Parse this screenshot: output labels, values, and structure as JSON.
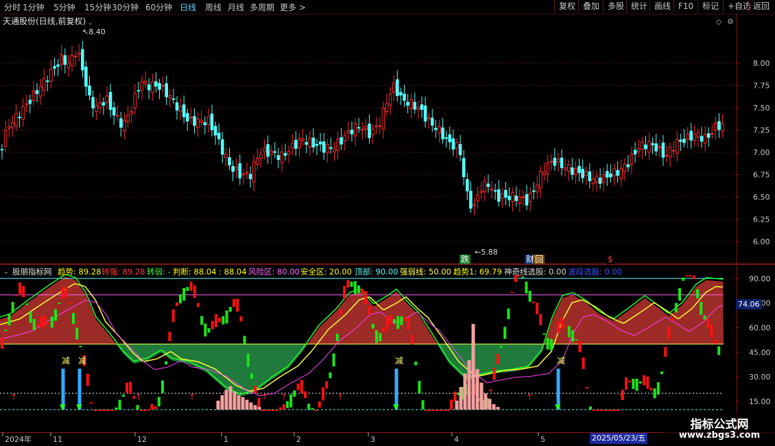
{
  "toolbar": {
    "periods": [
      "分时",
      "1分钟",
      "5分钟",
      "15分钟",
      "30分钟",
      "60分钟",
      "日线",
      "周线",
      "月线",
      "多周期",
      "更多 >"
    ],
    "active_period": "日线",
    "right_buttons": [
      "复权",
      "叠加",
      "多股",
      "统计",
      "画线",
      "F10",
      "标记",
      "+自选",
      "返回"
    ]
  },
  "main": {
    "title": "天通股份(日线,前复权)",
    "high_marker": "8.40",
    "low_marker": "5.88",
    "event_markers": [
      "跌",
      "财",
      "回",
      "$"
    ],
    "y_ticks": [
      "8.00",
      "7.75",
      "7.50",
      "7.25",
      "7.00",
      "6.75",
      "6.50",
      "6.25",
      "6.00"
    ]
  },
  "indicator": {
    "name": "股朋指标网",
    "fields": [
      {
        "label": "趋势:",
        "value": "89.28",
        "color": "#ffff00"
      },
      {
        "label": "转强:",
        "value": "89.28",
        "color": "#ff3c3c"
      },
      {
        "label": "转弱:",
        "value": "-",
        "color": "#3cff3c"
      },
      {
        "label": "判断:",
        "value": "88.04 : 88.04",
        "color": "#ffff00"
      },
      {
        "label": "风险区:",
        "value": "80.00",
        "color": "#ff66ff"
      },
      {
        "label": "安全区:",
        "value": "20.00",
        "color": "#ffff00"
      },
      {
        "label": "顶部:",
        "value": "90.00",
        "color": "#55ffff"
      },
      {
        "label": "强弱线:",
        "value": "50.00",
        "color": "#ffff55"
      },
      {
        "label": "趋势1:",
        "value": "69.79",
        "color": "#ffff00"
      },
      {
        "label": "神奇线选股:",
        "value": "0.00",
        "color": "#dddddd"
      },
      {
        "label": "波段选股:",
        "value": "0.00",
        "color": "#3355ff"
      }
    ],
    "y_ticks": [
      "90.00",
      "75.00",
      "60.00",
      "45.00",
      "30.00",
      "15.00"
    ],
    "current_value": "74.06",
    "signal_labels": [
      "减",
      "减",
      "减",
      "减"
    ]
  },
  "x_axis": {
    "labels": [
      "2024年",
      "11",
      "12",
      "1",
      "2",
      "3",
      "4",
      "5"
    ],
    "cursor_date": "2025/05/23/五"
  },
  "watermark": {
    "line1": "指标公式网",
    "line2": "www.zbgs3.com"
  },
  "colors": {
    "up": "#ff2b2b",
    "down": "#54ffff",
    "bg": "#000000",
    "grid": "#8a1a1a",
    "ind_up": "#ff1010",
    "ind_down": "#19e619",
    "fill_red": "#9c2a26",
    "fill_green": "#1f7a3b"
  }
}
